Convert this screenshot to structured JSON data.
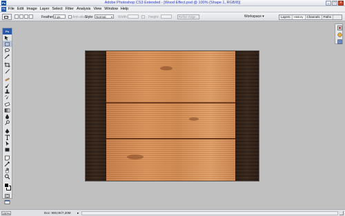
{
  "window": {
    "title": "Adobe Photoshop CS3 Extended - [Wood Effect.psd @ 100% (Shape 1, RGB/8)]",
    "app_icon": "Ps",
    "minimize": "_",
    "maximize": "□",
    "close": "×"
  },
  "menu": {
    "logo": "Ps",
    "items": [
      "File",
      "Edit",
      "Image",
      "Layer",
      "Select",
      "Filter",
      "Analysis",
      "View",
      "Window",
      "Help"
    ]
  },
  "options": {
    "feather_label": "Feather:",
    "feather_value": "0 px",
    "antialias_label": "Anti-alias",
    "style_label": "Style:",
    "style_value": "Normal",
    "width_label": "Width:",
    "height_label": "Height:",
    "refine_edge": "Refine Edge...",
    "workspace": "Workspace ▾"
  },
  "palette_well": {
    "tabs": [
      "Layers",
      "History",
      "Channels",
      "Paths"
    ]
  },
  "toolbox": {
    "header": "Ps"
  },
  "status": {
    "zoom": "100%",
    "doc": "Doc: 900,0K/7,20M",
    "arrow": "▸"
  },
  "colors": {
    "foreground": "#000000",
    "background": "#ffffff",
    "accent": "#2a5aa8"
  }
}
